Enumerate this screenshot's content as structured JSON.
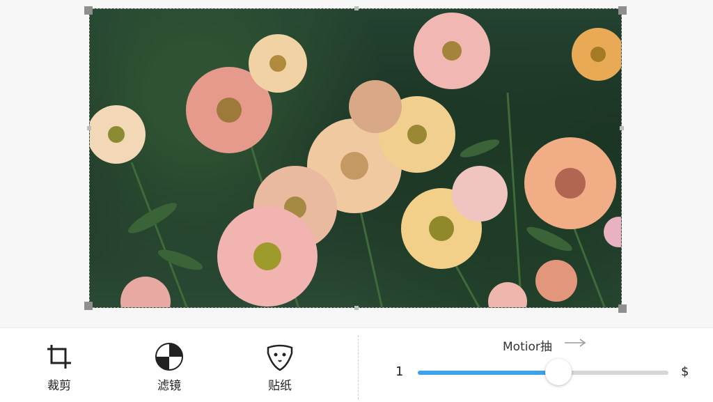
{
  "toolbar": {
    "tools": [
      {
        "label": "裁剪",
        "icon": "crop-icon"
      },
      {
        "label": "滤镜",
        "icon": "filter-icon"
      },
      {
        "label": "贴纸",
        "icon": "sticker-icon"
      }
    ]
  },
  "motion": {
    "title": "Motior抽",
    "arrow_icon": "arrow-right-icon",
    "slider": {
      "min_label": "1",
      "max_label": "$",
      "value_fraction": 0.56,
      "fill_color": "#3ea2ea",
      "track_color": "#d6d6d6"
    }
  },
  "image": {
    "subject": "flowers-photo"
  }
}
